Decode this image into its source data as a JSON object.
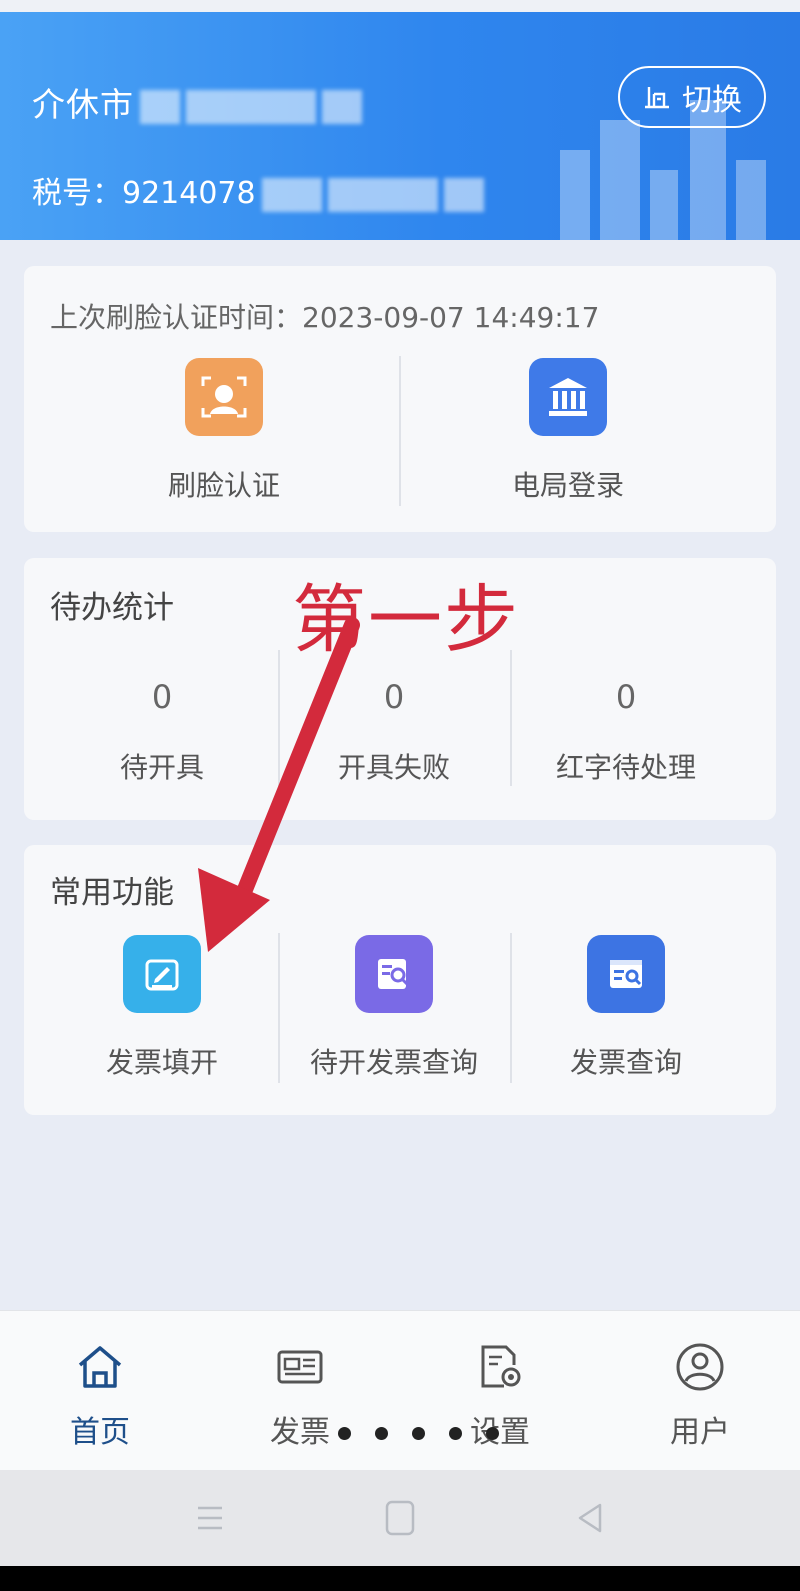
{
  "header": {
    "company_prefix": "介休市",
    "tax_label": "税号：",
    "tax_prefix": "9214078",
    "switch_label": "切换"
  },
  "auth_card": {
    "last_auth_label": "上次刷脸认证时间：",
    "last_auth_time": "2023-09-07 14:49:17",
    "face_label": "刷脸认证",
    "bureau_label": "电局登录"
  },
  "todo": {
    "title": "待办统计",
    "items": [
      {
        "count": "0",
        "label": "待开具"
      },
      {
        "count": "0",
        "label": "开具失败"
      },
      {
        "count": "0",
        "label": "红字待处理"
      }
    ]
  },
  "functions": {
    "title": "常用功能",
    "items": [
      {
        "label": "发票填开",
        "icon": "edit-invoice-icon"
      },
      {
        "label": "待开发票查询",
        "icon": "pending-invoice-search-icon"
      },
      {
        "label": "发票查询",
        "icon": "invoice-search-icon"
      }
    ]
  },
  "annotation": {
    "step_text": "第一步"
  },
  "bottom_nav": {
    "items": [
      {
        "label": "首页",
        "icon": "home-icon"
      },
      {
        "label": "发票",
        "icon": "invoice-icon"
      },
      {
        "label": "设置",
        "icon": "settings-icon"
      },
      {
        "label": "用户",
        "icon": "user-icon"
      }
    ]
  },
  "colors": {
    "header_blue": "#2f86ee",
    "annotation_red": "#d32a3c",
    "active_nav": "#1e4f8a"
  }
}
